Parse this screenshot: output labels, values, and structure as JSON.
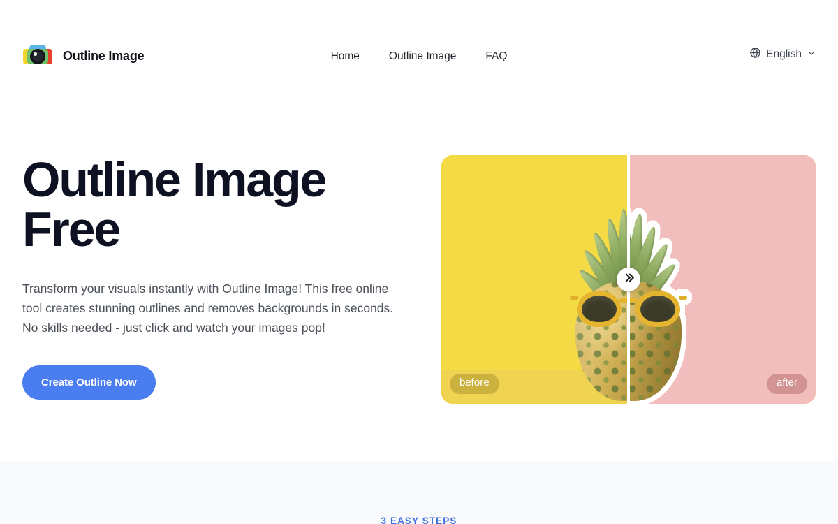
{
  "header": {
    "brand_name": "Outline Image",
    "logo_icon": "camera-logo-icon",
    "nav": [
      {
        "label": "Home"
      },
      {
        "label": "Outline Image"
      },
      {
        "label": "FAQ"
      }
    ],
    "language": {
      "globe_icon": "globe-icon",
      "label": "English",
      "chevron_icon": "chevron-down-icon"
    }
  },
  "hero": {
    "title": "Outline Image Free",
    "subtitle": "Transform your visuals instantly with Outline Image! This free online tool creates stunning outlines and removes backgrounds in seconds. No skills needed - just click and watch your images pop!",
    "cta_label": "Create Outline Now",
    "cta_color": "#4a7df0",
    "compare": {
      "before_label": "before",
      "after_label": "after",
      "handle_icon": "double-chevron-right-icon",
      "before_bg_color": "#f4db45",
      "after_bg_color": "#f2bdbd",
      "subject": "pineapple-with-sunglasses",
      "divider_position_percent": 50
    }
  },
  "steps_section": {
    "eyebrow": "3 EASY STEPS",
    "eyebrow_color": "#3f6fe0",
    "background_color": "#f9fafb"
  }
}
